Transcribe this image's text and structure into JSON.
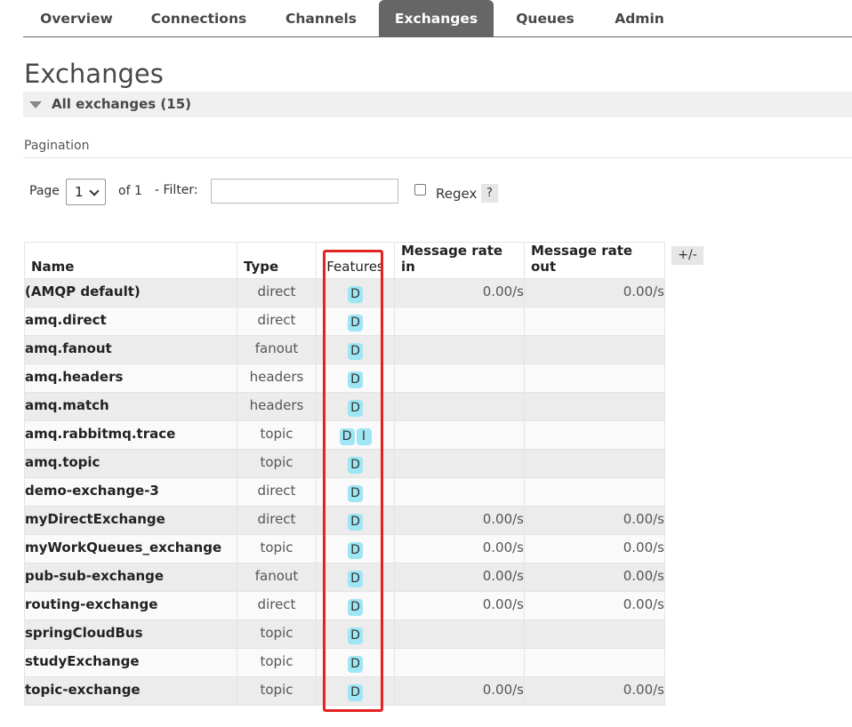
{
  "nav": {
    "tabs": [
      {
        "label": "Overview"
      },
      {
        "label": "Connections"
      },
      {
        "label": "Channels"
      },
      {
        "label": "Exchanges",
        "active": true
      },
      {
        "label": "Queues"
      },
      {
        "label": "Admin"
      }
    ]
  },
  "page": {
    "title": "Exchanges",
    "section_label": "All exchanges (15)"
  },
  "pagination": {
    "label": "Pagination",
    "page_label": "Page",
    "page_value": "1",
    "of_label": "of 1",
    "filter_label": "- Filter:",
    "filter_value": "",
    "regex_label": "Regex",
    "regex_checked": false,
    "help_label": "?"
  },
  "table": {
    "columns": [
      "Name",
      "Type",
      "Features",
      "Message rate in",
      "Message rate out"
    ],
    "column_toggle_label": "+/-",
    "rows": [
      {
        "name": "(AMQP default)",
        "type": "direct",
        "features": [
          "D"
        ],
        "rate_in": "0.00/s",
        "rate_out": "0.00/s"
      },
      {
        "name": "amq.direct",
        "type": "direct",
        "features": [
          "D"
        ],
        "rate_in": "",
        "rate_out": ""
      },
      {
        "name": "amq.fanout",
        "type": "fanout",
        "features": [
          "D"
        ],
        "rate_in": "",
        "rate_out": ""
      },
      {
        "name": "amq.headers",
        "type": "headers",
        "features": [
          "D"
        ],
        "rate_in": "",
        "rate_out": ""
      },
      {
        "name": "amq.match",
        "type": "headers",
        "features": [
          "D"
        ],
        "rate_in": "",
        "rate_out": ""
      },
      {
        "name": "amq.rabbitmq.trace",
        "type": "topic",
        "features": [
          "D",
          "I"
        ],
        "rate_in": "",
        "rate_out": ""
      },
      {
        "name": "amq.topic",
        "type": "topic",
        "features": [
          "D"
        ],
        "rate_in": "",
        "rate_out": ""
      },
      {
        "name": "demo-exchange-3",
        "type": "direct",
        "features": [
          "D"
        ],
        "rate_in": "",
        "rate_out": ""
      },
      {
        "name": "myDirectExchange",
        "type": "direct",
        "features": [
          "D"
        ],
        "rate_in": "0.00/s",
        "rate_out": "0.00/s"
      },
      {
        "name": "myWorkQueues_exchange",
        "type": "topic",
        "features": [
          "D"
        ],
        "rate_in": "0.00/s",
        "rate_out": "0.00/s"
      },
      {
        "name": "pub-sub-exchange",
        "type": "fanout",
        "features": [
          "D"
        ],
        "rate_in": "0.00/s",
        "rate_out": "0.00/s"
      },
      {
        "name": "routing-exchange",
        "type": "direct",
        "features": [
          "D"
        ],
        "rate_in": "0.00/s",
        "rate_out": "0.00/s"
      },
      {
        "name": "springCloudBus",
        "type": "topic",
        "features": [
          "D"
        ],
        "rate_in": "",
        "rate_out": ""
      },
      {
        "name": "studyExchange",
        "type": "topic",
        "features": [
          "D"
        ],
        "rate_in": "",
        "rate_out": ""
      },
      {
        "name": "topic-exchange",
        "type": "topic",
        "features": [
          "D"
        ],
        "rate_in": "0.00/s",
        "rate_out": "0.00/s"
      }
    ]
  },
  "colors": {
    "nav_active_bg": "#666666",
    "badge_bg": "#9ee6f4",
    "row_odd_bg": "#ececec",
    "row_even_bg": "#fafafa",
    "highlight_box": "#e32222"
  }
}
